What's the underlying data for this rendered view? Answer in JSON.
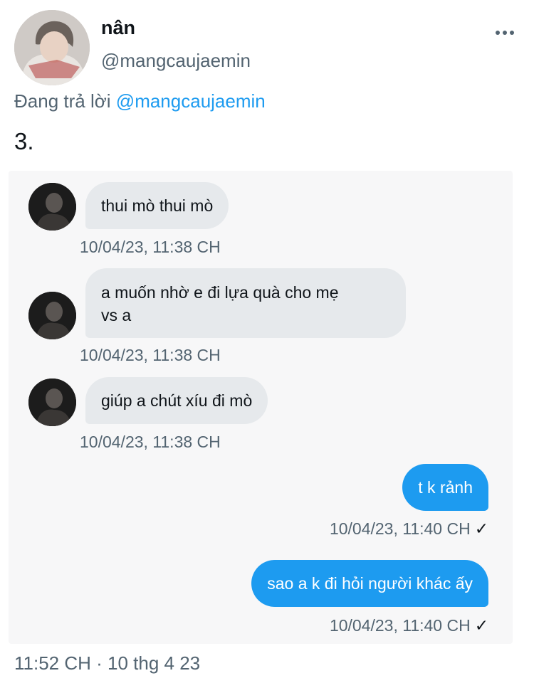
{
  "tweet": {
    "author_name": "nân",
    "author_handle": "@mangcaujaemin",
    "reply_prefix": "Đang trả lời",
    "reply_to": "@mangcaujaemin",
    "text": "3.",
    "footer_time": "11:52 CH · 10 thg 4 23",
    "more_icon": "more-horizontal-icon"
  },
  "chat": {
    "incoming": [
      {
        "text": "thui mò thui mò",
        "time": "10/04/23, 11:38 CH"
      },
      {
        "text_line1": "a muốn nhờ e đi lựa quà cho mẹ",
        "text_line2": "vs a",
        "time": "10/04/23, 11:38 CH"
      },
      {
        "text": "giúp a chút xíu đi mò",
        "time": "10/04/23, 11:38 CH"
      }
    ],
    "outgoing": [
      {
        "text": "t k rảnh",
        "time": "10/04/23, 11:40 CH",
        "status": "✓"
      },
      {
        "text": "sao a k đi hỏi người khác ấy",
        "time": "10/04/23, 11:40 CH",
        "status": "✓"
      }
    ]
  },
  "colors": {
    "accent": "#1d9bf0",
    "incoming_bubble": "#e6e9ec",
    "secondary_text": "#536471"
  }
}
